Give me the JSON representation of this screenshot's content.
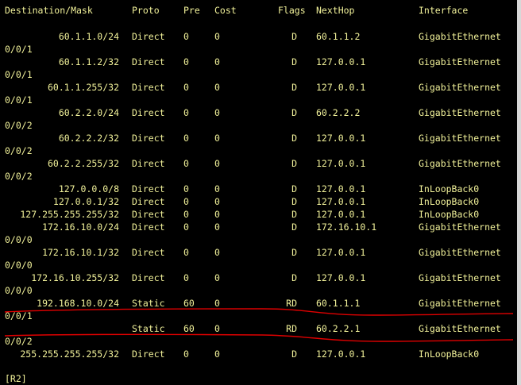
{
  "headers": {
    "destination": "Destination/Mask",
    "proto": "Proto",
    "pre": "Pre",
    "cost": "Cost",
    "flags": "Flags",
    "nexthop": "NextHop",
    "interface": "Interface"
  },
  "routes": [
    {
      "dest": "60.1.1.0/24",
      "proto": "Direct",
      "pre": "0",
      "cost": "0",
      "flags": "D",
      "nexthop": "60.1.1.2",
      "iface": "GigabitEthernet",
      "iface_wrap": "0/0/1"
    },
    {
      "dest": "60.1.1.2/32",
      "proto": "Direct",
      "pre": "0",
      "cost": "0",
      "flags": "D",
      "nexthop": "127.0.0.1",
      "iface": "GigabitEthernet",
      "iface_wrap": "0/0/1"
    },
    {
      "dest": "60.1.1.255/32",
      "proto": "Direct",
      "pre": "0",
      "cost": "0",
      "flags": "D",
      "nexthop": "127.0.0.1",
      "iface": "GigabitEthernet",
      "iface_wrap": "0/0/1"
    },
    {
      "dest": "60.2.2.0/24",
      "proto": "Direct",
      "pre": "0",
      "cost": "0",
      "flags": "D",
      "nexthop": "60.2.2.2",
      "iface": "GigabitEthernet",
      "iface_wrap": "0/0/2"
    },
    {
      "dest": "60.2.2.2/32",
      "proto": "Direct",
      "pre": "0",
      "cost": "0",
      "flags": "D",
      "nexthop": "127.0.0.1",
      "iface": "GigabitEthernet",
      "iface_wrap": "0/0/2"
    },
    {
      "dest": "60.2.2.255/32",
      "proto": "Direct",
      "pre": "0",
      "cost": "0",
      "flags": "D",
      "nexthop": "127.0.0.1",
      "iface": "GigabitEthernet",
      "iface_wrap": "0/0/2"
    },
    {
      "dest": "127.0.0.0/8",
      "proto": "Direct",
      "pre": "0",
      "cost": "0",
      "flags": "D",
      "nexthop": "127.0.0.1",
      "iface": "InLoopBack0",
      "iface_wrap": ""
    },
    {
      "dest": "127.0.0.1/32",
      "proto": "Direct",
      "pre": "0",
      "cost": "0",
      "flags": "D",
      "nexthop": "127.0.0.1",
      "iface": "InLoopBack0",
      "iface_wrap": ""
    },
    {
      "dest": "127.255.255.255/32",
      "proto": "Direct",
      "pre": "0",
      "cost": "0",
      "flags": "D",
      "nexthop": "127.0.0.1",
      "iface": "InLoopBack0",
      "iface_wrap": ""
    },
    {
      "dest": "172.16.10.0/24",
      "proto": "Direct",
      "pre": "0",
      "cost": "0",
      "flags": "D",
      "nexthop": "172.16.10.1",
      "iface": "GigabitEthernet",
      "iface_wrap": "0/0/0"
    },
    {
      "dest": "172.16.10.1/32",
      "proto": "Direct",
      "pre": "0",
      "cost": "0",
      "flags": "D",
      "nexthop": "127.0.0.1",
      "iface": "GigabitEthernet",
      "iface_wrap": "0/0/0"
    },
    {
      "dest": "172.16.10.255/32",
      "proto": "Direct",
      "pre": "0",
      "cost": "0",
      "flags": "D",
      "nexthop": "127.0.0.1",
      "iface": "GigabitEthernet",
      "iface_wrap": "0/0/0"
    },
    {
      "dest": "192.168.10.0/24",
      "proto": "Static",
      "pre": "60",
      "cost": "0",
      "flags": "RD",
      "nexthop": "60.1.1.1",
      "iface": "GigabitEthernet",
      "iface_wrap": "0/0/1"
    },
    {
      "dest": "",
      "proto": "Static",
      "pre": "60",
      "cost": "0",
      "flags": "RD",
      "nexthop": "60.2.2.1",
      "iface": "GigabitEthernet",
      "iface_wrap": "0/0/2"
    },
    {
      "dest": "255.255.255.255/32",
      "proto": "Direct",
      "pre": "0",
      "cost": "0",
      "flags": "D",
      "nexthop": "127.0.0.1",
      "iface": "InLoopBack0",
      "iface_wrap": ""
    }
  ],
  "prompt": "[R2]",
  "colors": {
    "background": "#000000",
    "text": "#f2f29a",
    "annotation": "#e00000"
  }
}
